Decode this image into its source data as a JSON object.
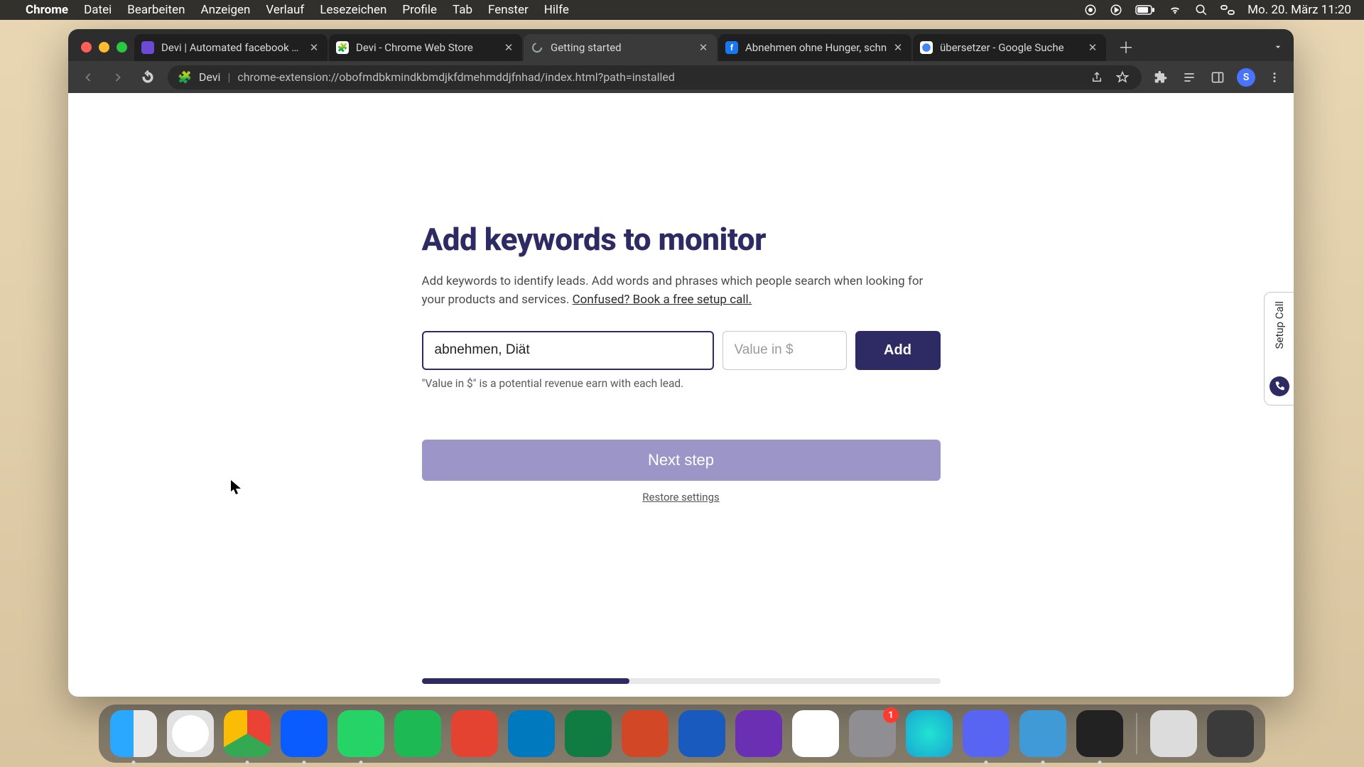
{
  "menubar": {
    "app": "Chrome",
    "items": [
      "Datei",
      "Bearbeiten",
      "Anzeigen",
      "Verlauf",
      "Lesezeichen",
      "Profile",
      "Tab",
      "Fenster",
      "Hilfe"
    ],
    "clock": "Mo. 20. März  11:20"
  },
  "tabs": [
    {
      "title": "Devi | Automated facebook gro",
      "favicon": "devi",
      "active": false
    },
    {
      "title": "Devi - Chrome Web Store",
      "favicon": "webstore",
      "active": false
    },
    {
      "title": "Getting started",
      "favicon": "spinner",
      "active": true
    },
    {
      "title": "Abnehmen ohne Hunger, schn",
      "favicon": "facebook",
      "active": false
    },
    {
      "title": "übersetzer - Google Suche",
      "favicon": "google",
      "active": false
    }
  ],
  "omnibox": {
    "chip": "Devi",
    "url": "chrome-extension://obofmdbkmindkbmdjkfdmehmddjfnhad/index.html?path=installed",
    "profile_initial": "S"
  },
  "page": {
    "title": "Add keywords to monitor",
    "subtitle_a": "Add keywords to identify leads. Add words and phrases which people search when looking for your products and services. ",
    "subtitle_link": "Confused? Book a free setup call.",
    "keyword_value": "abnehmen, Diät",
    "value_placeholder": "Value in $",
    "add_label": "Add",
    "hint": "\"Value in $\" is a potential revenue earn with each lead.",
    "next_label": "Next step",
    "restore_label": "Restore settings",
    "side_tab_label": "Setup Call",
    "progress_pct": 40
  },
  "dock": {
    "apps": [
      {
        "name": "finder",
        "badge": null,
        "running": true
      },
      {
        "name": "safari",
        "badge": null,
        "running": false
      },
      {
        "name": "chrome",
        "badge": null,
        "running": true
      },
      {
        "name": "zoom",
        "badge": null,
        "running": true
      },
      {
        "name": "whatsapp",
        "badge": null,
        "running": true
      },
      {
        "name": "spotify",
        "badge": null,
        "running": false
      },
      {
        "name": "todoist",
        "badge": null,
        "running": false
      },
      {
        "name": "trello",
        "badge": null,
        "running": false
      },
      {
        "name": "excel",
        "badge": null,
        "running": false
      },
      {
        "name": "powerpoint",
        "badge": null,
        "running": false
      },
      {
        "name": "word",
        "badge": null,
        "running": false
      },
      {
        "name": "imovie",
        "badge": null,
        "running": false
      },
      {
        "name": "google-drive",
        "badge": null,
        "running": false
      },
      {
        "name": "system-settings",
        "badge": "1",
        "running": false
      },
      {
        "name": "siri",
        "badge": null,
        "running": false
      },
      {
        "name": "discord",
        "badge": null,
        "running": true
      },
      {
        "name": "quicktime",
        "badge": null,
        "running": true
      },
      {
        "name": "voice-memos",
        "badge": null,
        "running": true
      }
    ],
    "right": [
      {
        "name": "preview",
        "badge": null
      },
      {
        "name": "trash",
        "badge": null
      }
    ]
  }
}
